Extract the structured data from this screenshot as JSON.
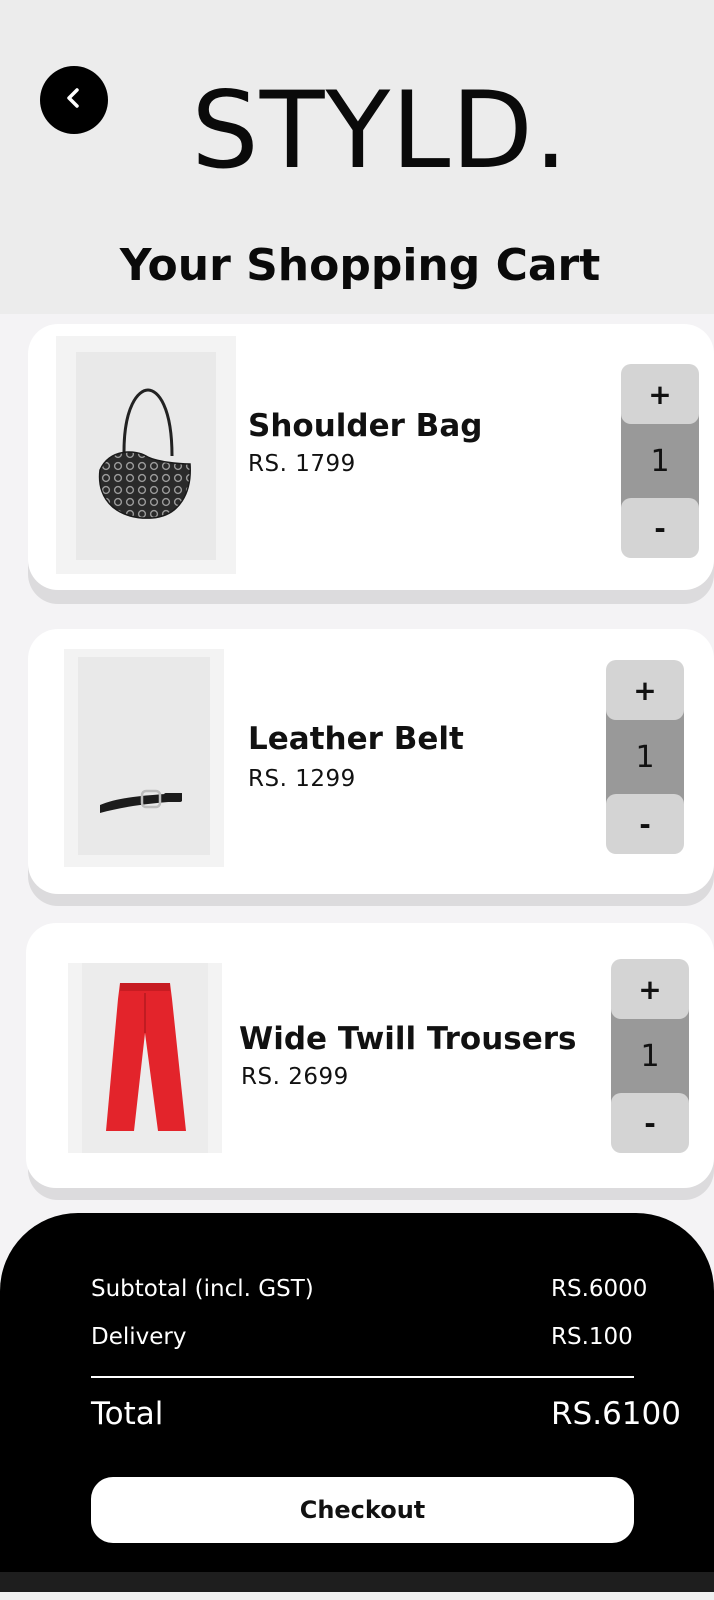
{
  "app": {
    "brand": "STYLD.",
    "title": "Your Shopping Cart",
    "back_icon": "chevron-left-icon"
  },
  "cart": {
    "items": [
      {
        "name": "Shoulder Bag",
        "price": "RS. 1799",
        "quantity": "1",
        "plus": "+",
        "minus": "-",
        "image": "shoulder-bag-image"
      },
      {
        "name": "Leather Belt",
        "price": "RS. 1299",
        "quantity": "1",
        "plus": "+",
        "minus": "-",
        "image": "leather-belt-image"
      },
      {
        "name": "Wide Twill Trousers",
        "price": "RS. 2699",
        "quantity": "1",
        "plus": "+",
        "minus": "-",
        "image": "red-trousers-image"
      }
    ]
  },
  "summary": {
    "subtotal_label": "Subtotal (incl. GST)",
    "subtotal_value": "RS.6000",
    "delivery_label": "Delivery",
    "delivery_value": "RS.100",
    "total_label": "Total",
    "total_value": "RS.6100",
    "checkout_label": "Checkout"
  },
  "colors": {
    "header_bg": "#ececec",
    "panel_bg": "#000000",
    "trousers_red": "#e3242b"
  }
}
